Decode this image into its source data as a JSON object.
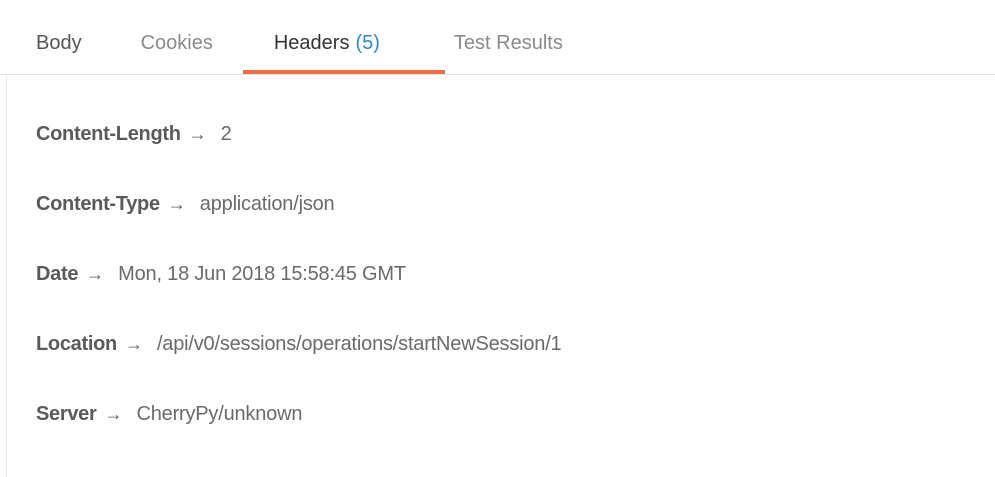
{
  "tabs": [
    {
      "label": "Body"
    },
    {
      "label": "Cookies"
    },
    {
      "label": "Headers",
      "count": "(5)"
    },
    {
      "label": "Test Results"
    }
  ],
  "active_tab": "Headers",
  "arrow": "→",
  "headers": [
    {
      "key": "Content-Length",
      "value": "2"
    },
    {
      "key": "Content-Type",
      "value": "application/json"
    },
    {
      "key": "Date",
      "value": "Mon, 18 Jun 2018 15:58:45 GMT"
    },
    {
      "key": "Location",
      "value": "/api/v0/sessions/operations/startNewSession/1"
    },
    {
      "key": "Server",
      "value": "CherryPy/unknown"
    }
  ],
  "colors": {
    "active_underline": "#f26b3a",
    "count_accent": "#2f86d2"
  }
}
